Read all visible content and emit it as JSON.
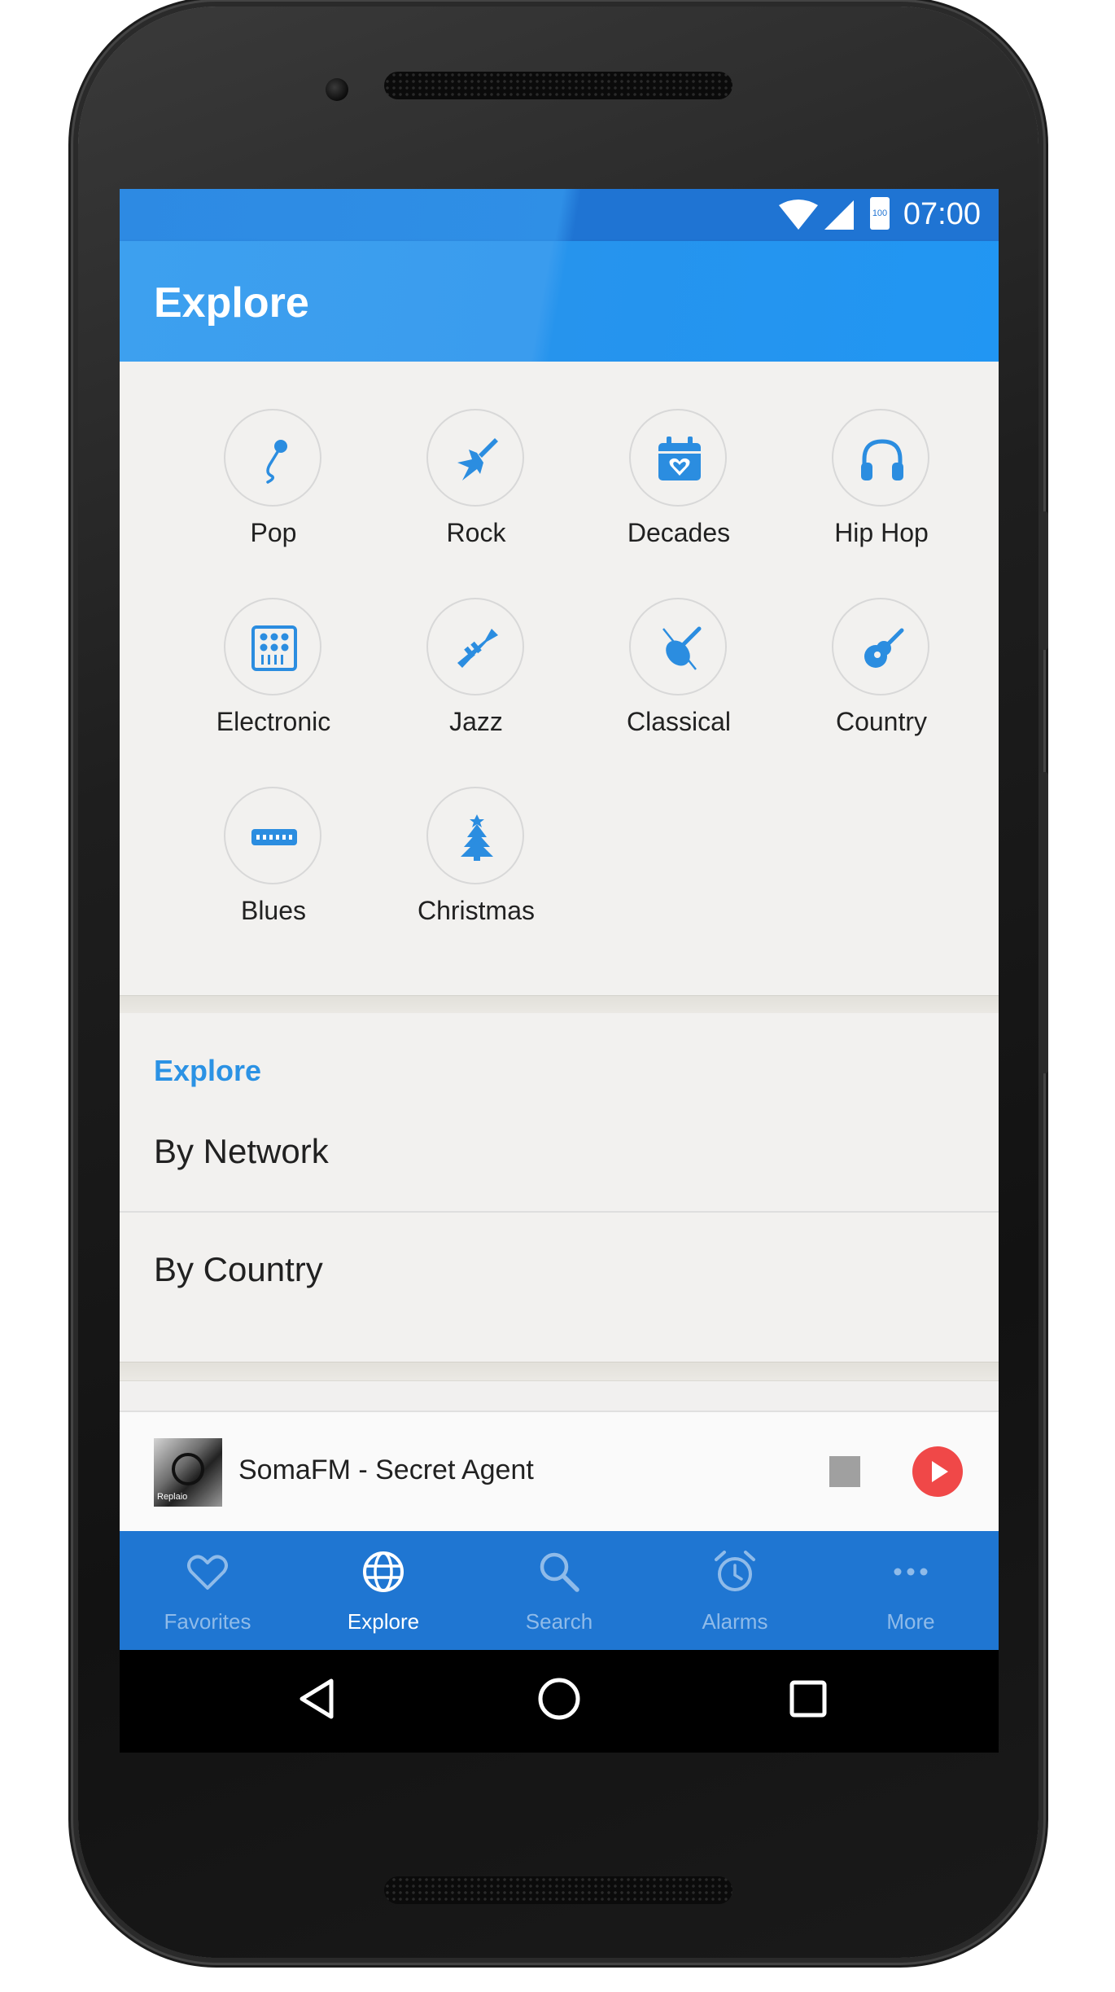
{
  "status_bar": {
    "time": "07:00",
    "battery_label": "100"
  },
  "app_bar": {
    "title": "Explore"
  },
  "genres": [
    {
      "label": "Pop",
      "icon": "microphone-icon"
    },
    {
      "label": "Rock",
      "icon": "electric-guitar-icon"
    },
    {
      "label": "Decades",
      "icon": "calendar-heart-icon"
    },
    {
      "label": "Hip Hop",
      "icon": "headphones-icon"
    },
    {
      "label": "Electronic",
      "icon": "drum-pad-icon"
    },
    {
      "label": "Jazz",
      "icon": "trumpet-icon"
    },
    {
      "label": "Classical",
      "icon": "violin-icon"
    },
    {
      "label": "Country",
      "icon": "acoustic-guitar-icon"
    },
    {
      "label": "Blues",
      "icon": "harmonica-icon"
    },
    {
      "label": "Christmas",
      "icon": "christmas-tree-icon"
    }
  ],
  "explore_section": {
    "header": "Explore",
    "items": [
      {
        "label": "By Network"
      },
      {
        "label": "By Country"
      }
    ]
  },
  "player": {
    "title": "SomaFM - Secret Agent",
    "thumb_caption": "Replaio"
  },
  "bottom_nav": [
    {
      "label": "Favorites",
      "icon": "heart-icon",
      "active": false
    },
    {
      "label": "Explore",
      "icon": "globe-icon",
      "active": true
    },
    {
      "label": "Search",
      "icon": "search-icon",
      "active": false
    },
    {
      "label": "Alarms",
      "icon": "alarm-clock-icon",
      "active": false
    },
    {
      "label": "More",
      "icon": "more-dots-icon",
      "active": false
    }
  ],
  "colors": {
    "primary": "#2196f3",
    "status_bar": "#1f74d3",
    "bottom_nav": "#1f76d2",
    "accent_text": "#2b92e4",
    "play_button": "#f04848",
    "icon_blue": "#2b8de0"
  }
}
